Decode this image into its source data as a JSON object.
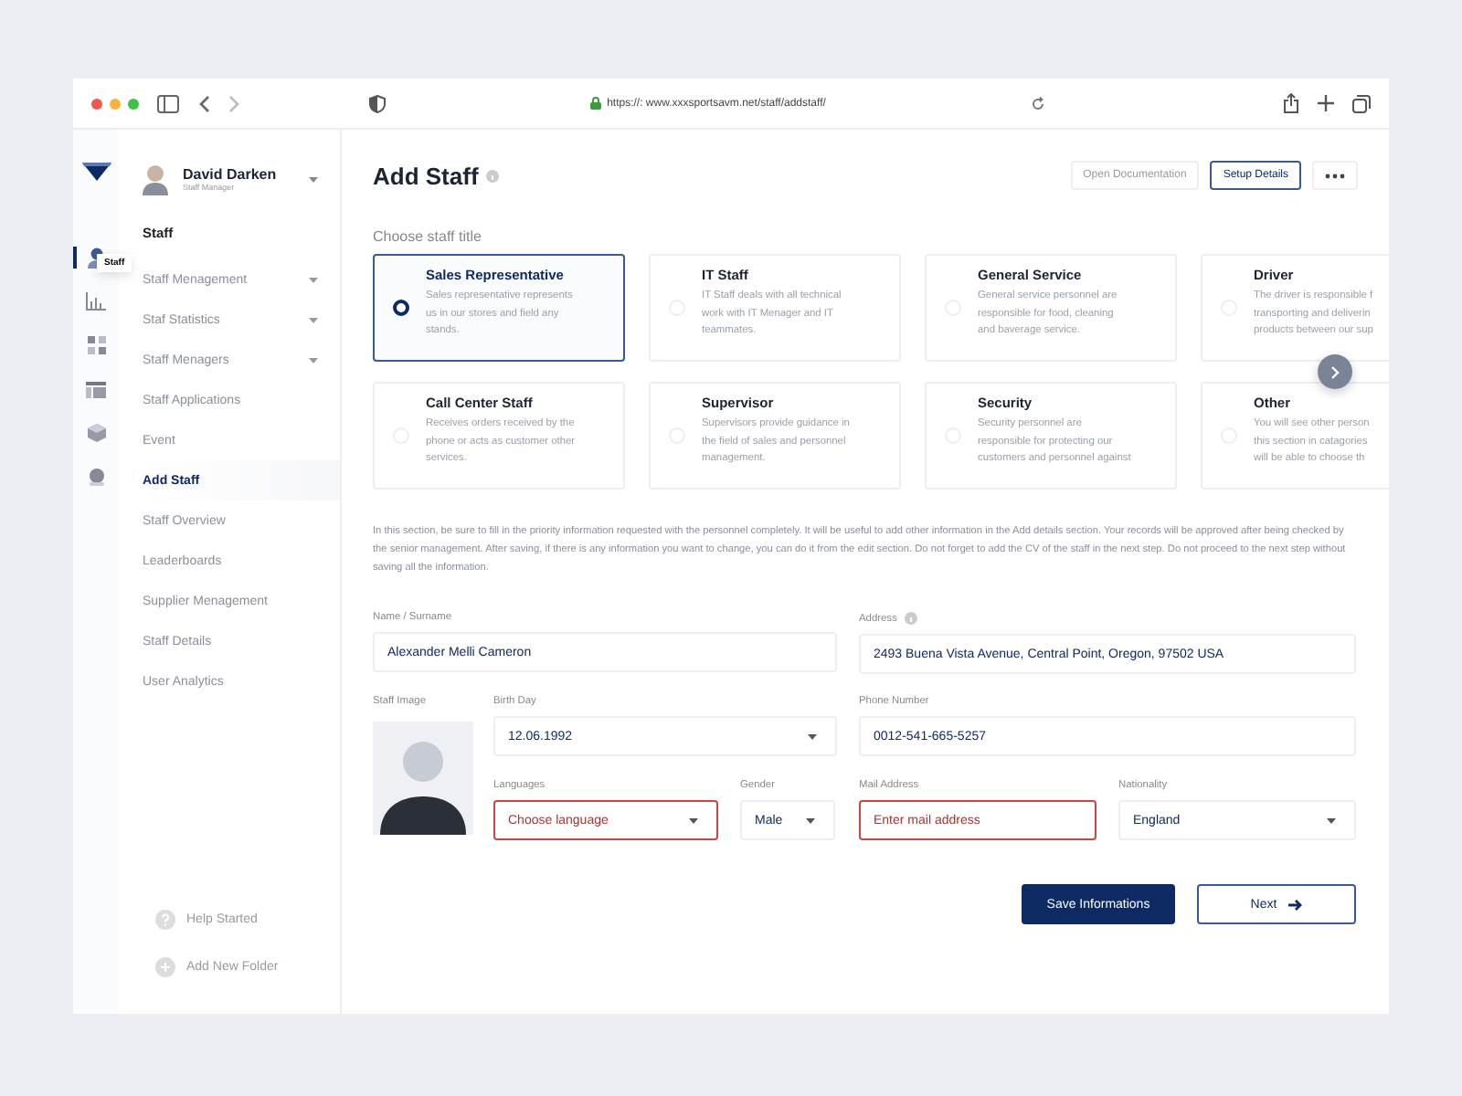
{
  "browser": {
    "url": "https://: www.xxxsportsavm.net/staff/addstaff/"
  },
  "rail": {
    "items": [
      {
        "kind": "person",
        "selected": true
      },
      {
        "kind": "chart",
        "selected": false
      },
      {
        "kind": "grid",
        "selected": false
      },
      {
        "kind": "table",
        "selected": false
      },
      {
        "kind": "box",
        "selected": false
      },
      {
        "kind": "dot",
        "selected": false
      }
    ],
    "tooltip": "Staff"
  },
  "profile": {
    "name": "David Darken",
    "role": "Staff Manager"
  },
  "nav": {
    "heading": "Staff",
    "items": [
      {
        "label": "Staff Menagement",
        "has_submenu": true,
        "selected": false
      },
      {
        "label": "Staf Statistics",
        "has_submenu": true,
        "selected": false
      },
      {
        "label": "Staff Menagers",
        "has_submenu": true,
        "selected": false
      },
      {
        "label": "Staff Applications",
        "has_submenu": false,
        "selected": false
      },
      {
        "label": "Event",
        "has_submenu": false,
        "selected": false
      },
      {
        "label": "Add Staff",
        "has_submenu": false,
        "selected": true
      },
      {
        "label": "Staff Overview",
        "has_submenu": false,
        "selected": false
      },
      {
        "label": "Leaderboards",
        "has_submenu": false,
        "selected": false
      },
      {
        "label": "Supplier Menagement",
        "has_submenu": false,
        "selected": false
      },
      {
        "label": "Staff Details",
        "has_submenu": false,
        "selected": false
      },
      {
        "label": "User Analytics",
        "has_submenu": false,
        "selected": false
      }
    ]
  },
  "sidebar_footer": [
    {
      "label": "Help Started",
      "kind": "help"
    },
    {
      "label": "Add New Folder",
      "kind": "add"
    }
  ],
  "header": {
    "title": "Add Staff",
    "buttons": [
      {
        "label": "Open Documentation",
        "kind": "plain"
      },
      {
        "label": "Setup Details",
        "kind": "outline"
      }
    ]
  },
  "staff_title": {
    "label": "Choose staff title",
    "options": [
      {
        "title": "Sales Representative",
        "lines": [
          "Sales representative represents",
          "us in our stores and field any",
          "stands."
        ],
        "selected": true
      },
      {
        "title": "IT Staff",
        "lines": [
          "IT Staff deals with all technical",
          "work with IT Menager and IT",
          "teammates."
        ],
        "selected": false
      },
      {
        "title": "General Service",
        "lines": [
          "General service personnel are",
          "responsible for food, cleaning",
          "and baverage service."
        ],
        "selected": false
      },
      {
        "title": "Driver",
        "lines": [
          "The driver is responsible f",
          "transporting and deliverin",
          "products between our sup"
        ],
        "selected": false
      },
      {
        "title": "Call Center Staff",
        "lines": [
          "Receives orders received by the",
          "phone or acts as customer other",
          "services."
        ],
        "selected": false
      },
      {
        "title": "Supervisor",
        "lines": [
          "Supervisors provide guidance in",
          "the field of sales and personnel",
          "management."
        ],
        "selected": false
      },
      {
        "title": "Security",
        "lines": [
          "Security personnel are",
          "responsible for protecting our",
          "customers and personnel against"
        ],
        "selected": false
      },
      {
        "title": "Other",
        "lines": [
          "You will see other person",
          "this section in catagories",
          "will be able to choose th"
        ],
        "selected": false
      }
    ]
  },
  "notice": "In this section, be sure to fill in the priority information requested with the personnel completely. It will be useful to add other information in the Add details section. Your records will be approved after being checked by the senior management. After saving, if there is any information you want to change, you can do it from the edit section. Do not forget to add the CV of the staff in the next step. Do not proceed to the next step without saving all the information.",
  "form": {
    "name": {
      "label": "Name / Surname",
      "value": "Alexander Melli Cameron",
      "kind": "input",
      "error": false
    },
    "address": {
      "label": "Address",
      "value": "2493  Buena Vista Avenue, Central Point, Oregon, 97502 USA",
      "kind": "input",
      "error": false
    },
    "staff_image": {
      "label": "Staff Image"
    },
    "birth_day": {
      "label": "Birth Day",
      "value": "12.06.1992",
      "kind": "select",
      "error": false
    },
    "phone": {
      "label": "Phone Number",
      "value": "0012-541-665-5257",
      "kind": "input",
      "error": false
    },
    "languages": {
      "label": "Languages",
      "placeholder": "Choose language",
      "kind": "select",
      "error": true
    },
    "gender": {
      "label": "Gender",
      "value": "Male",
      "kind": "select",
      "error": false
    },
    "mail": {
      "label": "Mail Address",
      "placeholder": "Enter mail address",
      "kind": "input",
      "error": true
    },
    "nationality": {
      "label": "Nationality",
      "value": "England",
      "kind": "select",
      "error": false
    }
  },
  "actions": [
    {
      "label": "Save Informations",
      "kind": "primary"
    },
    {
      "label": "Next",
      "kind": "secondary"
    }
  ]
}
